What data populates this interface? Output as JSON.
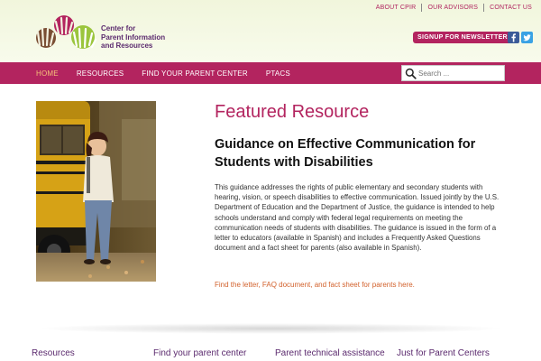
{
  "header": {
    "logo": {
      "lines": [
        "Center for",
        "Parent Information",
        "and Resources"
      ],
      "colors": {
        "purple": "#5b2a6e",
        "magenta": "#b3245f",
        "brown": "#6b3a1f",
        "green": "#9bc53d"
      }
    },
    "top_links": [
      "ABOUT CPIR",
      "OUR ADVISORS",
      "CONTACT US"
    ],
    "signup_label": "SIGNUP FOR NEWSLETTER",
    "social": [
      "facebook-icon",
      "twitter-icon"
    ]
  },
  "nav": {
    "items": [
      {
        "label": "HOME",
        "active": true
      },
      {
        "label": "RESOURCES",
        "active": false
      },
      {
        "label": "FIND YOUR PARENT CENTER",
        "active": false
      },
      {
        "label": "PTACS",
        "active": false
      }
    ],
    "search_placeholder": "Search ...",
    "color": "#b3245f"
  },
  "main": {
    "photo_alt": "Girl standing beside a school bus",
    "heading": "Featured Resource",
    "title": "Guidance on Effective Communication for Students with Disabilities",
    "body": "This guidance addresses the rights of public elementary and secondary students with hearing, vision, or speech disabilities to effective communication. Issued jointly by the U.S. Department of Education and the Department of Justice, the guidance is intended to help schools understand and comply with federal legal requirements on meeting the communication needs of students with disabilities. The guidance is issued in the form of a letter to educators (available in Spanish) and includes a Frequently Asked Questions document and a fact sheet for parents (also available in Spanish).",
    "link": "Find the letter, FAQ document, and fact sheet for parents here."
  },
  "footer": {
    "columns": [
      "Resources",
      "Find your parent center",
      "Parent technical assistance",
      "Just for Parent Centers"
    ]
  }
}
